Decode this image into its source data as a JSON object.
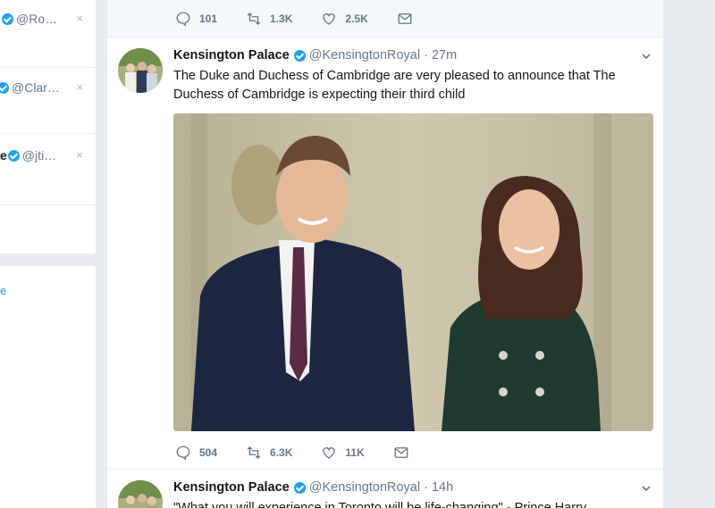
{
  "sidebar": {
    "who_to_follow": [
      {
        "name": "",
        "handle": "@Ro…"
      },
      {
        "name": "",
        "handle": "@Clar…"
      },
      {
        "name": "e",
        "handle": "@jti…"
      }
    ],
    "dismiss_label": "×",
    "link_text": "e"
  },
  "top_tweet": {
    "replies": "101",
    "retweets": "1.3K",
    "likes": "2.5K"
  },
  "tweet1": {
    "name": "Kensington Palace",
    "handle": "@KensingtonRoyal",
    "time": "· 27m",
    "text": "The Duke and Duchess of Cambridge are very pleased to announce that The Duchess of Cambridge is expecting their third child",
    "replies": "504",
    "retweets": "6.3K",
    "likes": "11K"
  },
  "tweet2": {
    "name": "Kensington Palace",
    "handle": "@KensingtonRoyal",
    "time": "· 14h",
    "text": "\"What you will experience in Toronto will be life-changing\" - Prince Harry"
  },
  "icons": {
    "reply": "reply-icon",
    "retweet": "retweet-icon",
    "like": "heart-icon",
    "dm": "envelope-icon",
    "verified": "verified-badge-icon",
    "caret": "chevron-down-icon"
  },
  "colors": {
    "accent": "#1da1f2",
    "muted": "#657786",
    "background": "#e6ecf0"
  }
}
